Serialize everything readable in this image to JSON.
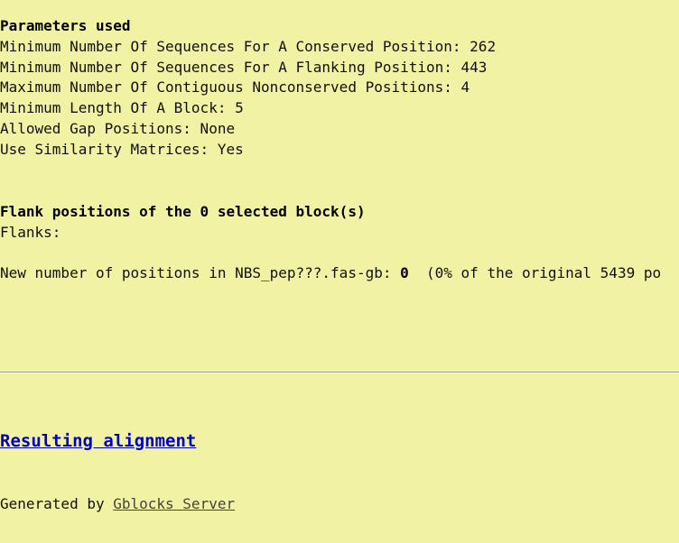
{
  "page": {
    "background_color": "#F2F2A5",
    "text_color": "#111111"
  },
  "parameters_section": {
    "heading": "Parameters used",
    "lines": [
      "Minimum Number Of Sequences For A Conserved Position: 262",
      "Minimum Number Of Sequences For A Flanking Position: 443",
      "Maximum Number Of Contiguous Nonconserved Positions: 4",
      "Minimum Length Of A Block: 5",
      "Allowed Gap Positions: None",
      "Use Similarity Matrices: Yes"
    ],
    "values": {
      "min_sequences_conserved_position": "262",
      "min_sequences_flanking_position": "443",
      "max_contiguous_nonconserved_positions": "4",
      "min_length_of_block": "5",
      "allowed_gap_positions": "None",
      "use_similarity_matrices": "Yes"
    }
  },
  "flank_section": {
    "heading": "Flank positions of the 0 selected block(s)",
    "selected_block_count": "0",
    "flanks_label": "Flanks:"
  },
  "new_number_section": {
    "prefix": "New number of positions in NBS_pep???.fas-gb: ",
    "count": "0",
    "suffix": "  (0% of the original 5439 po",
    "filename": "NBS_pep???.fas-gb",
    "percent_of_original": "0%",
    "original_positions": "5439"
  },
  "result_link": {
    "label": "Resulting alignment",
    "color": "#0000C8"
  },
  "footer": {
    "generated_by_text": "Generated by ",
    "server_link_label": "Gblocks Server",
    "link_color": "#444444"
  }
}
